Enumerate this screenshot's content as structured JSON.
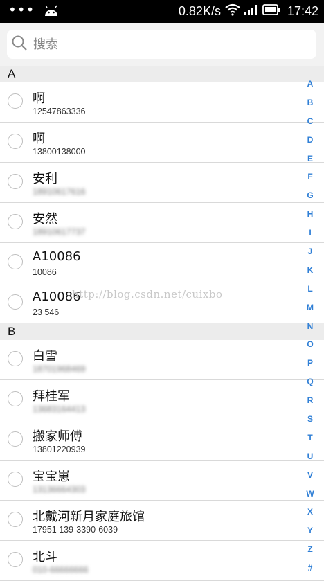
{
  "status_bar": {
    "left_icons": [
      "more-dots-icon",
      "android-icon"
    ],
    "dots": "•••",
    "network_speed": "0.82K/s",
    "right_icons": [
      "wifi-icon",
      "signal-icon",
      "battery-icon"
    ],
    "time": "17:42"
  },
  "search": {
    "placeholder": "搜索",
    "value": "",
    "icon": "search-icon"
  },
  "sections": [
    {
      "letter": "A",
      "contacts": [
        {
          "name": "啊",
          "phone": "12547863336",
          "blurred": false
        },
        {
          "name": "啊",
          "phone": "13800138000",
          "blurred": false
        },
        {
          "name": "安利",
          "phone": "18910617616",
          "blurred": true
        },
        {
          "name": "安然",
          "phone": "18910617737",
          "blurred": true
        },
        {
          "name": "A10086",
          "phone": "10086",
          "blurred": false
        },
        {
          "name": "A10086",
          "phone": "23 546",
          "blurred": false
        }
      ]
    },
    {
      "letter": "B",
      "contacts": [
        {
          "name": "白雪",
          "phone": "18701968469",
          "blurred": true
        },
        {
          "name": "拜桂军",
          "phone": "13683164413",
          "blurred": true
        },
        {
          "name": "搬家师傅",
          "phone": "13801220939",
          "blurred": false
        },
        {
          "name": "宝宝崽",
          "phone": "13136664303",
          "blurred": true
        },
        {
          "name": "北戴河新月家庭旅馆",
          "phone": "17951 139-3390-6039",
          "blurred": false
        },
        {
          "name": "北斗",
          "phone": "010-66666666",
          "blurred": true
        }
      ]
    }
  ],
  "index_letters": [
    "A",
    "B",
    "C",
    "D",
    "E",
    "F",
    "G",
    "H",
    "I",
    "J",
    "K",
    "L",
    "M",
    "N",
    "O",
    "P",
    "Q",
    "R",
    "S",
    "T",
    "U",
    "V",
    "W",
    "X",
    "Y",
    "Z",
    "#"
  ],
  "watermark": "http://blog.csdn.net/cuixbo",
  "colors": {
    "index_letter": "#2f7fd6",
    "section_bg": "#ececec",
    "search_bg": "#f2f2f2",
    "divider": "#d9d9d9"
  }
}
